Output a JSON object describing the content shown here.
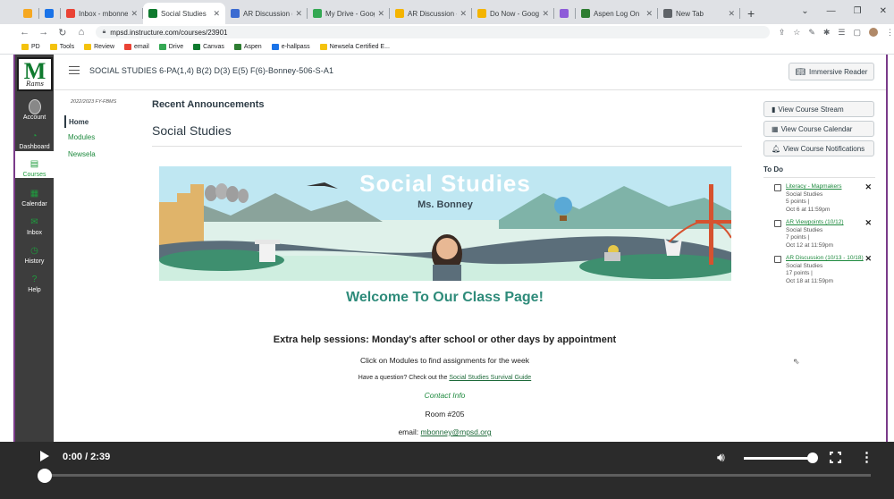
{
  "browser": {
    "tabs": [
      {
        "title": "",
        "fav_color": "#f6a821"
      },
      {
        "title": "",
        "fav_color": "#1a73e8"
      },
      {
        "title": "Inbox - mbonney@mpsd",
        "fav_color": "#ea4335"
      },
      {
        "title": "Social Studies",
        "fav_color": "#0f7a2e",
        "active": true
      },
      {
        "title": "AR Discussion (10/13 -",
        "fav_color": "#3b6bd1"
      },
      {
        "title": "My Drive - Google Drive",
        "fav_color": "#34a853"
      },
      {
        "title": "AR Discussion - Google",
        "fav_color": "#f4b400"
      },
      {
        "title": "Do Now - Google Slides",
        "fav_color": "#f4b400"
      },
      {
        "title": "",
        "fav_color": "#8e5cd9"
      },
      {
        "title": "Aspen Log On",
        "fav_color": "#2e7d32"
      },
      {
        "title": "New Tab",
        "fav_color": "#5f6368"
      }
    ],
    "new_tab_symbol": "+",
    "window_controls": [
      "⌄",
      "—",
      "❐",
      "✕"
    ],
    "url": "mpsd.instructure.com/courses/23901",
    "bookmarks": [
      {
        "label": "PD",
        "color": "#f4c20d"
      },
      {
        "label": "Tools",
        "color": "#f4c20d"
      },
      {
        "label": "Review",
        "color": "#f4c20d"
      },
      {
        "label": "email",
        "color": "#ea4335"
      },
      {
        "label": "Drive",
        "color": "#34a853"
      },
      {
        "label": "Canvas",
        "color": "#0f7a2e"
      },
      {
        "label": "Aspen",
        "color": "#2e7d32"
      },
      {
        "label": "e-hallpass",
        "color": "#1a73e8"
      },
      {
        "label": "Newsela Certified E...",
        "color": "#f4c20d"
      }
    ]
  },
  "globalnav": {
    "logo_letter": "M",
    "logo_text": "Rams",
    "items": [
      {
        "label": "Account",
        "icon": "account-icon"
      },
      {
        "label": "Dashboard",
        "icon": "dashboard-icon"
      },
      {
        "label": "Courses",
        "icon": "courses-icon",
        "active": true
      },
      {
        "label": "Calendar",
        "icon": "calendar-icon"
      },
      {
        "label": "Inbox",
        "icon": "inbox-icon"
      },
      {
        "label": "History",
        "icon": "history-icon"
      },
      {
        "label": "Help",
        "icon": "help-icon"
      }
    ]
  },
  "header": {
    "course_title": "SOCIAL STUDIES 6-PA(1,4) B(2) D(3) E(5) F(6)-Bonney-506-S-A1",
    "immersive_reader": "Immersive Reader"
  },
  "coursenav": {
    "term": "2022/2023 FY-FBMS",
    "items": [
      "Home",
      "Modules",
      "Newsela"
    ]
  },
  "main": {
    "recent_announcements": "Recent Announcements",
    "page_title": "Social Studies",
    "banner_title": "Social Studies",
    "banner_subtitle": "Ms. Bonney",
    "welcome": "Welcome To Our Class Page!",
    "extra_help": "Extra help sessions: Monday's after school or other days by appointment",
    "modules_line": "Click on Modules to find assignments for the week",
    "question_prefix": "Have a question? Check out the",
    "question_link": "Social Studies Survival Guide",
    "contact": "Contact Info",
    "room": "Room #205",
    "email_prefix": "email:",
    "email_link": "mbonney@mpsd.org"
  },
  "sidebar": {
    "buttons": [
      "View Course Stream",
      "View Course Calendar",
      "View Course Notifications"
    ],
    "todo_heading": "To Do",
    "todos": [
      {
        "title": "Literacy - Mapmakers",
        "course": "Social Studies",
        "points": "5 points  |",
        "due": "Oct 6 at 11:59pm"
      },
      {
        "title": "AR Viewpoints (10/12)",
        "course": "Social Studies",
        "points": "7 points  |",
        "due": "Oct 12 at 11:59pm"
      },
      {
        "title": "AR Discussion (10/13 - 10/18)",
        "course": "Social Studies",
        "points": "17 points  |",
        "due": "Oct 18 at 11:59pm"
      }
    ]
  },
  "video": {
    "time": "0:00 / 2:39",
    "progress": 0.0,
    "volume": 0.93
  }
}
